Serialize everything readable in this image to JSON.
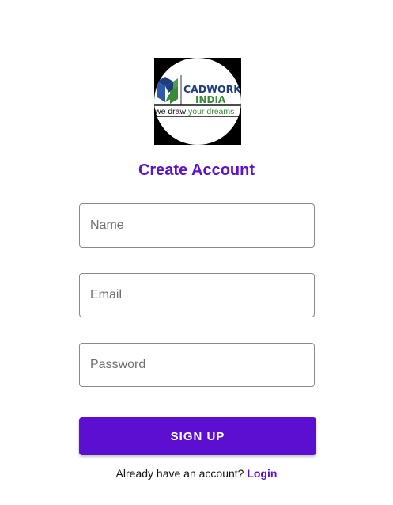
{
  "logo": {
    "brand_line1": "CADWORKS",
    "brand_line2": "INDIA",
    "tagline_part1": "we draw ",
    "tagline_part2": "your dreams",
    "icon": "cadworks-logo-icon",
    "colors": {
      "blue": "#1f3d7a",
      "green": "#3a8a3a",
      "background": "#000000"
    }
  },
  "page_title": "Create Account",
  "form": {
    "name": {
      "placeholder": "Name",
      "value": ""
    },
    "email": {
      "placeholder": "Email",
      "value": ""
    },
    "password": {
      "placeholder": "Password",
      "value": ""
    },
    "submit_label": "SIGN UP"
  },
  "footer": {
    "prompt": "Already have an account? ",
    "login_link": "Login"
  },
  "colors": {
    "accent": "#5a0fd1",
    "title": "#5a12cc",
    "border": "#8a8a8a"
  }
}
